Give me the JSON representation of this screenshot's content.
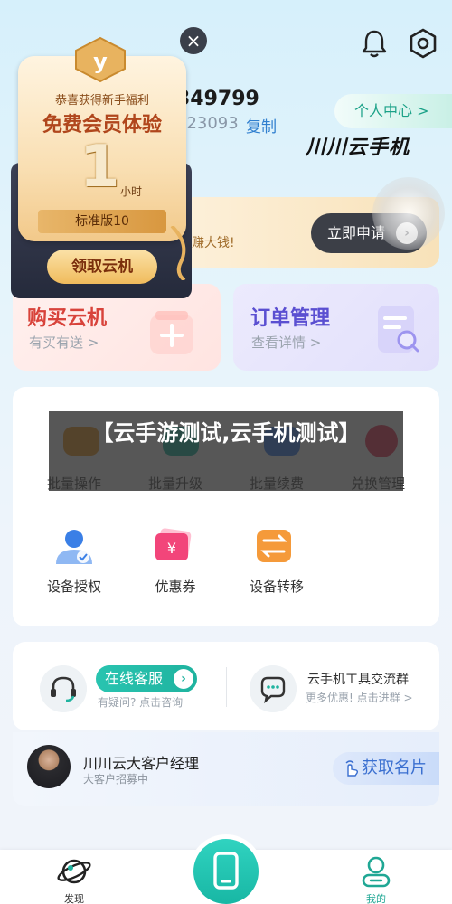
{
  "header": {
    "close_icon": "×",
    "bell_icon": "bell-icon",
    "settings_icon": "gear-icon"
  },
  "profile": {
    "uid_fragment": "349799",
    "uid2_fragment": "523093",
    "copy_label": "复制",
    "personal_center_label": "个人中心 >"
  },
  "watermark": "川川云手机",
  "banner": {
    "text": "赚大钱!",
    "apply_label": "立即申请",
    "apply_arrow": "›"
  },
  "popup": {
    "badge_letter": "y",
    "subtitle": "恭喜获得新手福利",
    "title": "免费会员体验",
    "number": "1",
    "unit": "小时",
    "plan": "标准版10",
    "claim_label": "领取云机"
  },
  "cards": {
    "buy": {
      "title": "购买云机",
      "sub": "有买有送 >"
    },
    "order": {
      "title": "订单管理",
      "sub": "查看详情 >"
    }
  },
  "overlay_text": "【云手游测试,云手机测试】",
  "tools": [
    {
      "label": "批量操作",
      "color": "#f0a23a"
    },
    {
      "label": "批量升级",
      "color": "#2bbfa8"
    },
    {
      "label": "批量续费",
      "color": "#4b8af0"
    },
    {
      "label": "兑换管理",
      "color": "#f04a6a"
    },
    {
      "label": "设备授权",
      "color": "#3a7fe6"
    },
    {
      "label": "优惠券",
      "color": "#f2457a"
    },
    {
      "label": "设备转移",
      "color": "#f59a3a"
    }
  ],
  "service": {
    "online_label": "在线客服",
    "online_arrow": "›",
    "online_sub": "有疑问? 点击咨询",
    "group_title": "云手机工具交流群",
    "group_sub": "更多优惠! 点击进群 >"
  },
  "manager": {
    "title": "川川云大客户经理",
    "sub": "大客户招募中",
    "card_label": "获取名片"
  },
  "nav": {
    "discover_label": "发现",
    "mine_label": "我的"
  }
}
